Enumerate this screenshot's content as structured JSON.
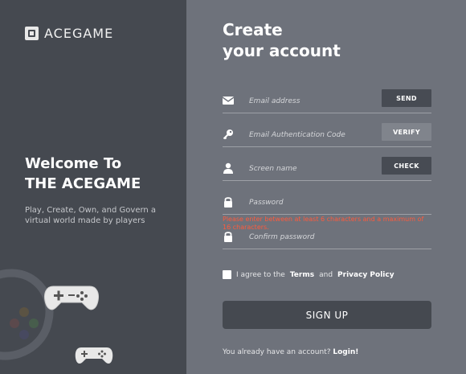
{
  "brand": {
    "name": "ACEGAME"
  },
  "left": {
    "welcome_line1": "Welcome To",
    "welcome_line2": "THE ACEGAME",
    "tagline": "Play, Create, Own, and Govern a virtual world made by players"
  },
  "form": {
    "title_line1": "Create",
    "title_line2": "your account",
    "email": {
      "placeholder": "Email address",
      "button": "SEND"
    },
    "code": {
      "placeholder": "Email Authentication Code",
      "button": "VERIFY"
    },
    "screen_name": {
      "placeholder": "Screen name",
      "button": "CHECK"
    },
    "password": {
      "placeholder": "Password"
    },
    "password_error": "Please enter between at least 6 characters and a maximum of 16 characters.",
    "confirm_password": {
      "placeholder": "Confirm password"
    },
    "agree": {
      "prefix": "I agree to the",
      "terms": "Terms",
      "and": "and",
      "privacy": "Privacy Policy"
    },
    "submit": "SIGN UP",
    "login_prompt": "You already have an account?",
    "login_link": "Login!"
  },
  "colors": {
    "left_panel": "#454950",
    "right_panel": "#6e727b",
    "error": "#ff5a3c",
    "button_dark": "#474b53"
  },
  "icons": [
    "envelope-icon",
    "key-icon",
    "person-icon",
    "lock-icon",
    "lock-icon",
    "gamepad-icon"
  ]
}
